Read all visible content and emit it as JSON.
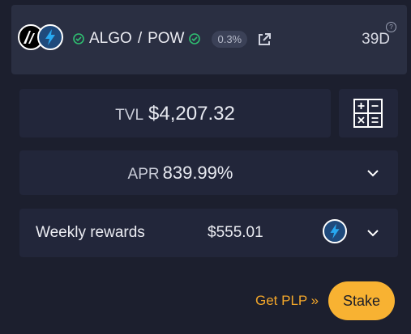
{
  "pool": {
    "token_a": "ALGO",
    "separator": "/",
    "token_b": "POW",
    "fee": "0.3%",
    "days": "39D",
    "help": "?"
  },
  "tvl": {
    "label": "TVL",
    "value": "$4,207.32"
  },
  "apr": {
    "label": "APR",
    "value": "839.99%"
  },
  "rewards": {
    "label": "Weekly rewards",
    "value": "$555.01"
  },
  "actions": {
    "get_plp": "Get PLP »",
    "stake": "Stake"
  },
  "colors": {
    "background": "#1c1f2e",
    "card": "#2a2f42",
    "panel": "#22263a",
    "verified_green": "#2fbf71",
    "accent": "#f8b232",
    "link": "#f2a62a"
  },
  "icons": {
    "token_a": "algo-icon",
    "token_b": "pow-icon",
    "verified": "verified-check-icon",
    "external": "external-link-icon",
    "calculator": "calculator-icon",
    "expand": "chevron-down-icon",
    "help": "help-icon"
  }
}
